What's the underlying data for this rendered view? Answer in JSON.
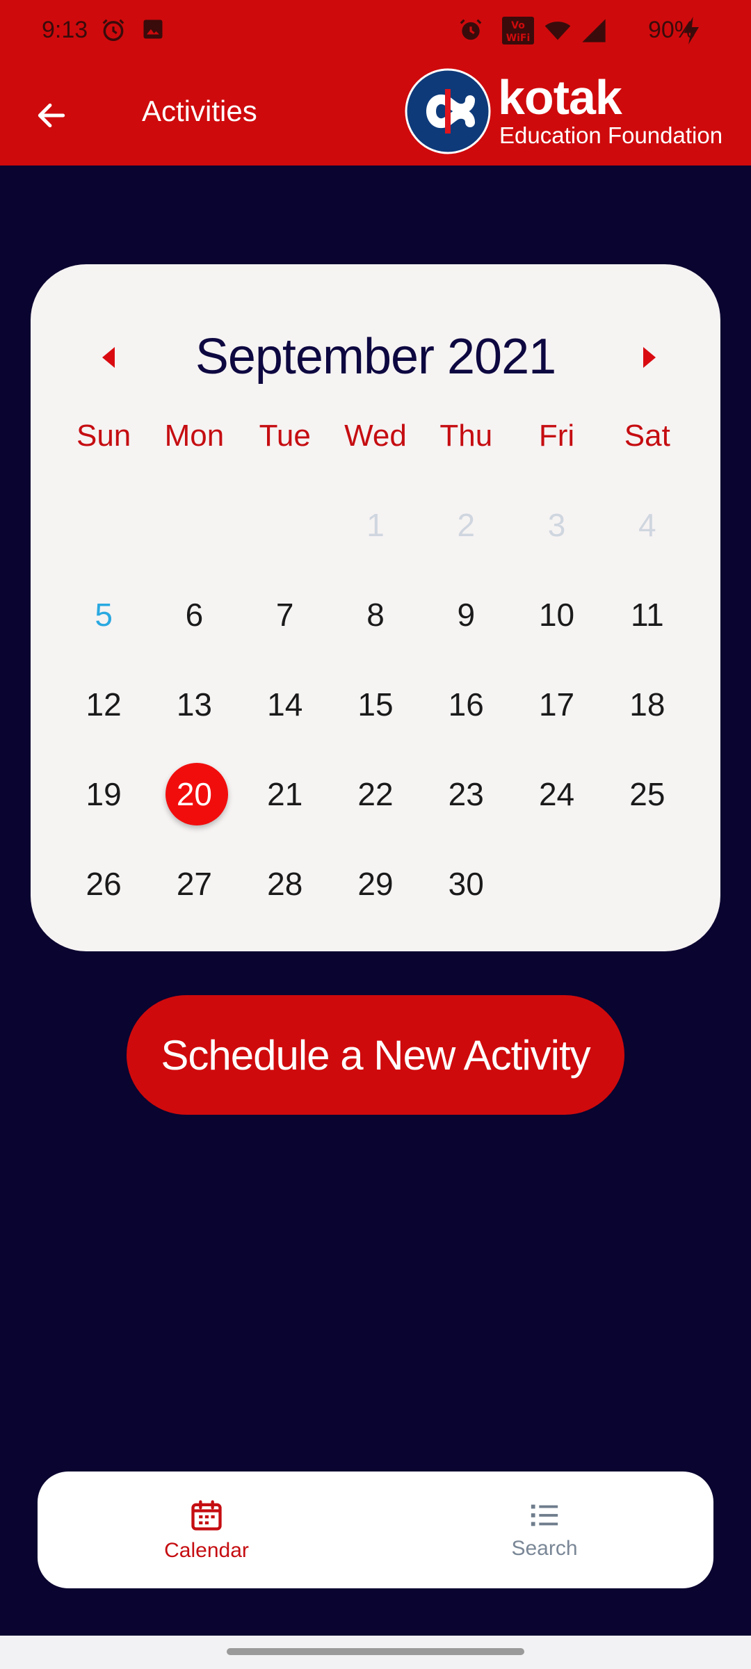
{
  "status_bar": {
    "time": "9:13",
    "battery": "90%",
    "icons": [
      "alarm-icon",
      "image-icon",
      "alarm-icon",
      "volte-wifi-icon",
      "wifi-icon",
      "signal-icon",
      "charging-icon"
    ]
  },
  "app_bar": {
    "title": "Activities",
    "logo_brand": "kotak",
    "logo_subtitle": "Education Foundation"
  },
  "calendar": {
    "month_label": "September 2021",
    "weekdays": [
      "Sun",
      "Mon",
      "Tue",
      "Wed",
      "Thu",
      "Fri",
      "Sat"
    ],
    "weeks": [
      [
        "",
        "",
        "",
        "1",
        "2",
        "3",
        "4"
      ],
      [
        "5",
        "6",
        "7",
        "8",
        "9",
        "10",
        "11"
      ],
      [
        "12",
        "13",
        "14",
        "15",
        "16",
        "17",
        "18"
      ],
      [
        "19",
        "20",
        "21",
        "22",
        "23",
        "24",
        "25"
      ],
      [
        "26",
        "27",
        "28",
        "29",
        "30",
        "",
        ""
      ]
    ],
    "selected_day": "20",
    "highlighted_day": "5"
  },
  "actions": {
    "schedule_label": "Schedule a New Activity"
  },
  "bottom_nav": {
    "items": [
      {
        "label": "Calendar",
        "icon": "calendar-icon",
        "active": true
      },
      {
        "label": "Search",
        "icon": "list-icon",
        "active": false
      }
    ]
  },
  "colors": {
    "brand_red": "#cf0a0c",
    "background_navy": "#0a0430",
    "selected_red": "#f20d0d",
    "highlight_blue": "#2aa9e0"
  }
}
